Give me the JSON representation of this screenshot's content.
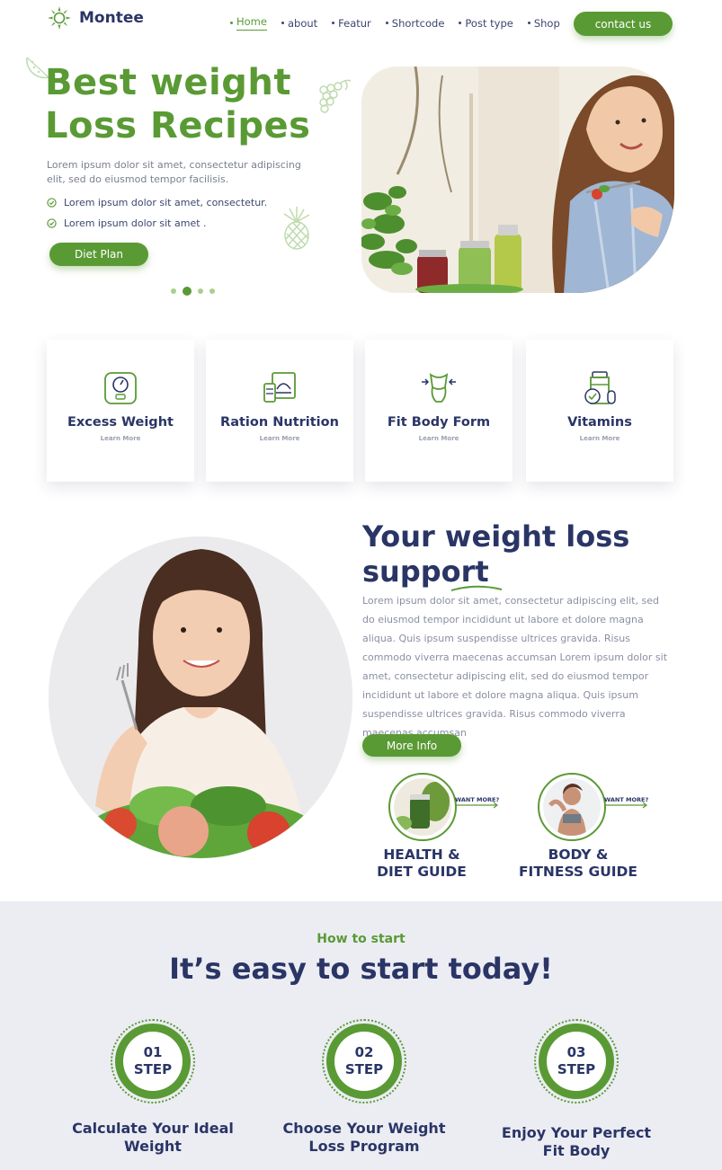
{
  "header": {
    "logo_text": "Montee",
    "nav": [
      {
        "label": "Home",
        "active": true
      },
      {
        "label": "about",
        "active": false
      },
      {
        "label": "Featur",
        "active": false
      },
      {
        "label": "Shortcode",
        "active": false
      },
      {
        "label": "Post type",
        "active": false
      },
      {
        "label": "Shop",
        "active": false
      }
    ],
    "contact_label": "contact us"
  },
  "hero": {
    "title_line1": "Best weight",
    "title_line2": "Loss Recipes",
    "description": "Lorem ipsum dolor sit amet, consectetur adipiscing elit, sed do eiusmod tempor facilisis.",
    "checks": [
      "Lorem ipsum dolor sit amet, consectetur.",
      "Lorem ipsum dolor sit amet ."
    ],
    "button_label": "Diet Plan",
    "slider_active_index": 1,
    "slider_count": 4
  },
  "features": [
    {
      "title": "Excess Weight",
      "link": "Learn More",
      "icon": "scale-icon"
    },
    {
      "title": "Ration Nutrition",
      "link": "Learn More",
      "icon": "nutrition-icon"
    },
    {
      "title": "Fit Body Form",
      "link": "Learn More",
      "icon": "body-form-icon"
    },
    {
      "title": "Vitamins",
      "link": "Learn More",
      "icon": "vitamins-icon"
    }
  ],
  "support": {
    "title_line1": "Your weight loss",
    "title_line2": "support",
    "body": "Lorem ipsum dolor sit amet, consectetur adipiscing elit, sed do eiusmod tempor incididunt ut labore et dolore magna aliqua. Quis ipsum suspendisse ultrices gravida. Risus commodo viverra maecenas accumsan Lorem ipsum dolor sit amet, consectetur adipiscing elit, sed do eiusmod tempor incididunt ut labore et dolore magna aliqua. Quis ipsum suspendisse ultrices gravida. Risus commodo viverra maecenas accumsan",
    "button_label": "More Info",
    "guides": [
      {
        "want": "WANT MORE?",
        "line1": "HEALTH &",
        "line2": "DIET GUIDE"
      },
      {
        "want": "WANT MORE?",
        "line1": "BODY &",
        "line2": "FITNESS GUIDE"
      }
    ]
  },
  "start": {
    "kicker": "How to start",
    "title": "It’s easy to start today!",
    "steps": [
      {
        "num": "01",
        "word": "STEP",
        "line1": "Calculate Your Ideal",
        "line2": "Weight"
      },
      {
        "num": "02",
        "word": "STEP",
        "line1": "Choose Your Weight",
        "line2": "Loss Program"
      },
      {
        "num": "03",
        "word": "STEP",
        "line1": "Enjoy Your Perfect",
        "line2": "Fit Body"
      }
    ]
  },
  "colors": {
    "accent": "#5a9a35",
    "navy": "#2a3566",
    "muted": "#8a8fa3",
    "section_bg": "#ecedf3"
  }
}
